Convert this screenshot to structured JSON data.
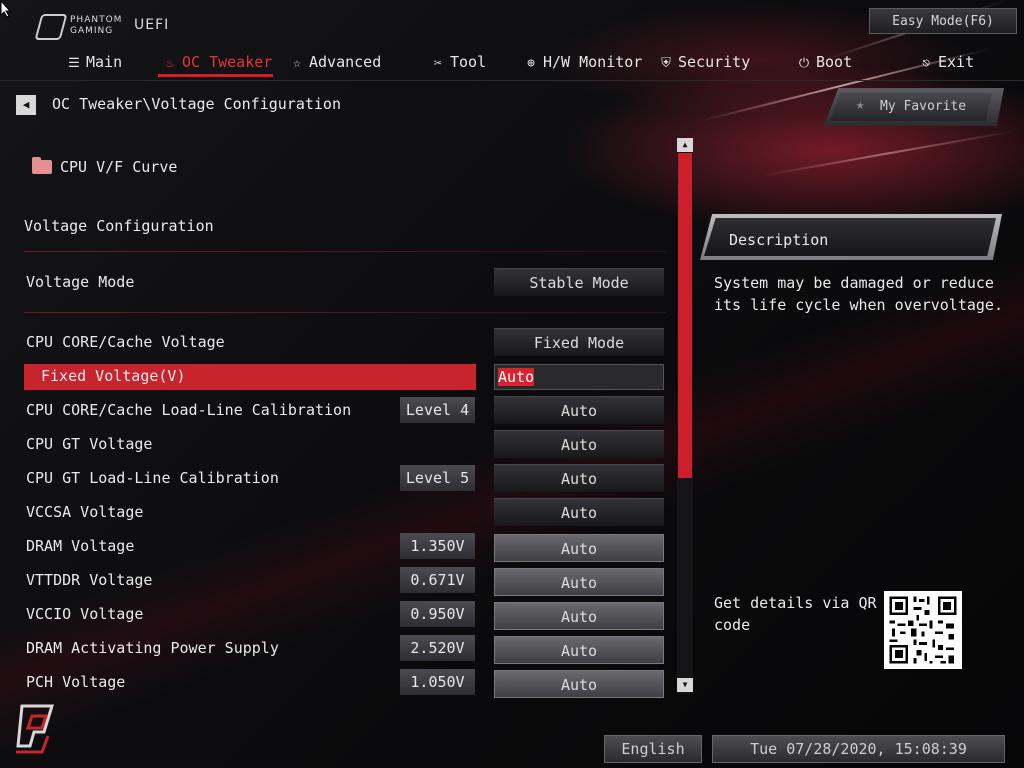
{
  "header": {
    "logo_line1": "PHANTOM",
    "logo_line2": "GAMING",
    "logo_uefi": "UEFI",
    "easy_mode_label": "Easy Mode(F6)"
  },
  "nav": {
    "items": [
      {
        "label": "Main",
        "icon": "list-icon"
      },
      {
        "label": "OC Tweaker",
        "icon": "flame-icon"
      },
      {
        "label": "Advanced",
        "icon": "star-icon"
      },
      {
        "label": "Tool",
        "icon": "tools-icon"
      },
      {
        "label": "H/W Monitor",
        "icon": "crosshair-icon"
      },
      {
        "label": "Security",
        "icon": "shield-icon"
      },
      {
        "label": "Boot",
        "icon": "power-icon"
      },
      {
        "label": "Exit",
        "icon": "exit-icon"
      }
    ],
    "active": "OC Tweaker"
  },
  "breadcrumb": "OC Tweaker\\Voltage Configuration",
  "favorite_label": "My Favorite",
  "submenu": {
    "label": "CPU V/F Curve"
  },
  "section_title": "Voltage Configuration",
  "voltage_mode": {
    "label": "Voltage Mode",
    "value": "Stable Mode"
  },
  "settings": [
    {
      "label": "CPU CORE/Cache Voltage",
      "value": "Fixed Mode"
    },
    {
      "label": "Fixed Voltage(V)",
      "value": "Auto"
    },
    {
      "label": "CPU CORE/Cache Load-Line Calibration",
      "current": "Level 4",
      "value": "Auto"
    },
    {
      "label": "CPU GT Voltage",
      "value": "Auto"
    },
    {
      "label": "CPU GT Load-Line Calibration",
      "current": "Level 5",
      "value": "Auto"
    },
    {
      "label": "VCCSA Voltage",
      "value": "Auto"
    },
    {
      "label": "DRAM Voltage",
      "current": "1.350V",
      "value": "Auto"
    },
    {
      "label": "VTTDDR Voltage",
      "current": "0.671V",
      "value": "Auto"
    },
    {
      "label": "VCCIO Voltage",
      "current": "0.950V",
      "value": "Auto"
    },
    {
      "label": "DRAM Activating Power Supply",
      "current": "2.520V",
      "value": "Auto"
    },
    {
      "label": "PCH Voltage",
      "current": "1.050V",
      "value": "Auto"
    }
  ],
  "description": {
    "title": "Description",
    "text": "System may be damaged or reduce its life cycle when overvoltage.",
    "qr_text": "Get details via QR code"
  },
  "footer": {
    "language": "English",
    "datetime": "Tue 07/28/2020, 15:08:39"
  },
  "colors": {
    "accent": "#d21f2b",
    "selected_row": "#c8242e",
    "background": "#0b0b0d"
  }
}
